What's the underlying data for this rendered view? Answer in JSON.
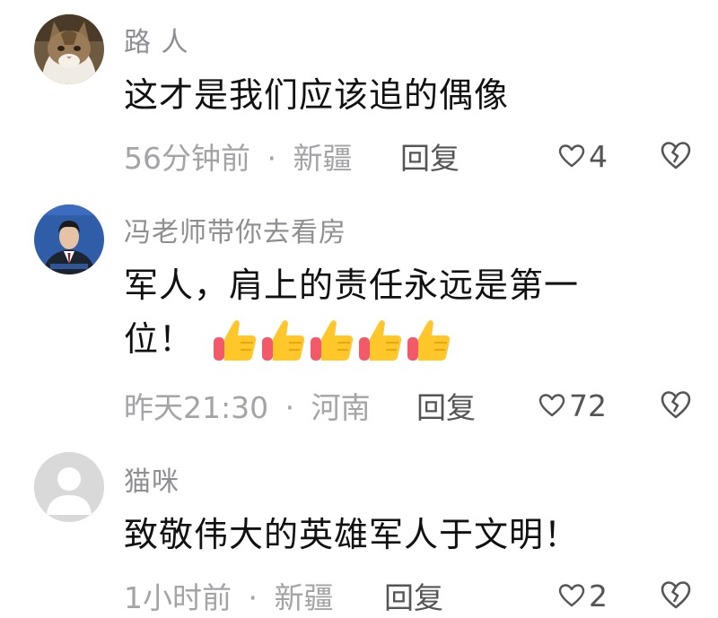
{
  "comments": [
    {
      "username": "路  人",
      "content": "这才是我们应该追的偶像",
      "time": "56分钟前",
      "separator": "·",
      "location": "新疆",
      "reply_label": "回复",
      "likes": "4",
      "avatar_icon": "cat-photo-avatar"
    },
    {
      "username": "冯老师带你去看房",
      "content_line1": "军人，肩上的责任永远是第一",
      "content_line2": "位！",
      "emoji": "thumbs-up x5",
      "time": "昨天21:30",
      "separator": "·",
      "location": "河南",
      "reply_label": "回复",
      "likes": "72",
      "avatar_icon": "man-in-suit-avatar"
    },
    {
      "username": "猫咪",
      "content": "致敬伟大的英雄军人于文明！",
      "time": "1小时前",
      "separator": "·",
      "location": "新疆",
      "reply_label": "回复",
      "likes": "2",
      "avatar_icon": "default-user-avatar"
    }
  ],
  "colors": {
    "username": "#8e8e93",
    "content": "#111111",
    "meta": "#a3a3a8",
    "action": "#555558",
    "default_avatar_bg": "#d9d9d9"
  }
}
